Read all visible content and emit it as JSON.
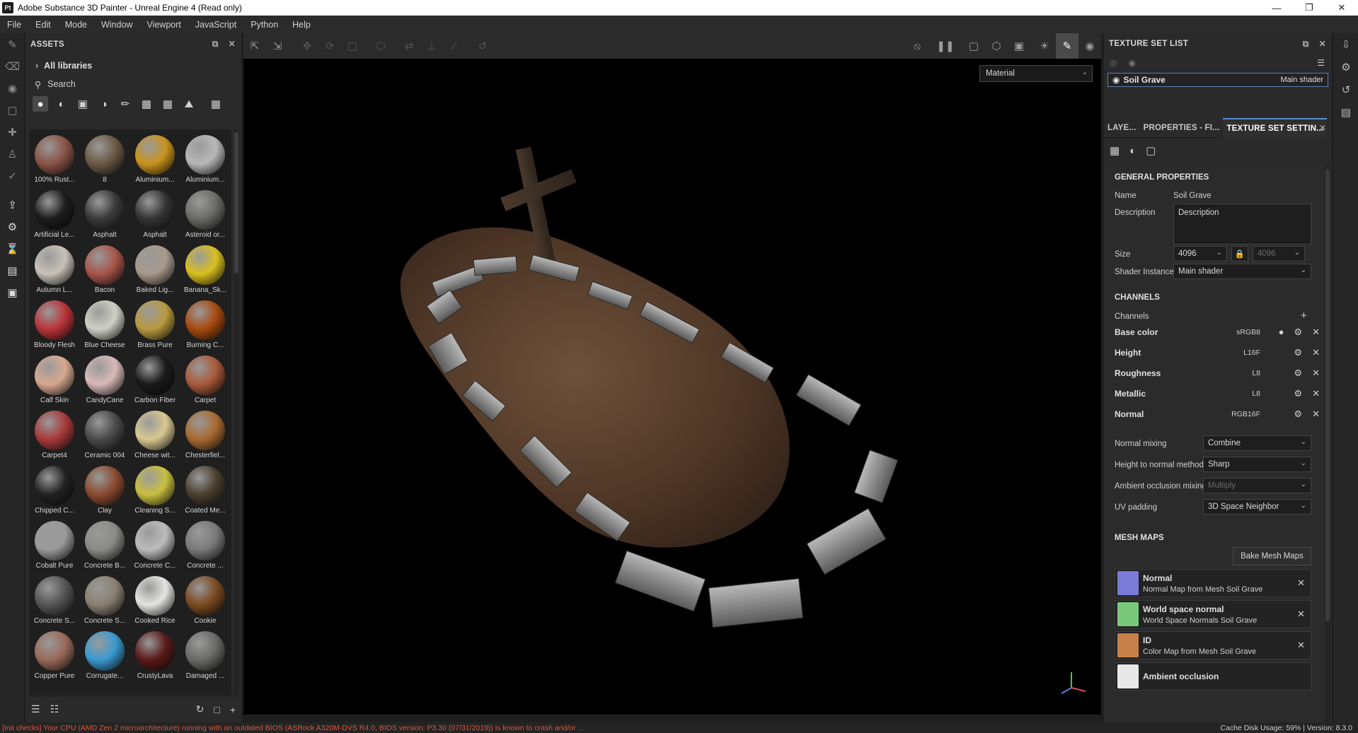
{
  "window": {
    "title": "Adobe Substance 3D Painter - Unreal Engine 4 (Read only)",
    "app_icon": "Pt"
  },
  "menu": [
    "File",
    "Edit",
    "Mode",
    "Window",
    "Viewport",
    "JavaScript",
    "Python",
    "Help"
  ],
  "assets": {
    "title": "ASSETS",
    "libraries": "All libraries",
    "search_placeholder": "Search",
    "items": [
      {
        "label": "100% Rust...",
        "color": "#8a5346"
      },
      {
        "label": "8",
        "color": "#6b5a44"
      },
      {
        "label": "Aluminium...",
        "color": "#c9931e"
      },
      {
        "label": "Aluminium...",
        "color": "#b8b8b8"
      },
      {
        "label": "Artificial Le...",
        "color": "#1c1c1c"
      },
      {
        "label": "Asphalt",
        "color": "#3a3a3a"
      },
      {
        "label": "Asphalt",
        "color": "#343434"
      },
      {
        "label": "Asteroid or...",
        "color": "#6b6b66"
      },
      {
        "label": "Autumn L...",
        "color": "#c8c0b8"
      },
      {
        "label": "Bacon",
        "color": "#a8554a"
      },
      {
        "label": "Baked Lig...",
        "color": "#a89a8c"
      },
      {
        "label": "Banana_Sk...",
        "color": "#d8c020"
      },
      {
        "label": "Bloody Flesh",
        "color": "#b8343a"
      },
      {
        "label": "Blue Cheese",
        "color": "#cfd0c4"
      },
      {
        "label": "Brass Pure",
        "color": "#b89a40"
      },
      {
        "label": "Burning C...",
        "color": "#a84a10"
      },
      {
        "label": "Calf Skin",
        "color": "#d8a890"
      },
      {
        "label": "CandyCane",
        "color": "#d8b8b8"
      },
      {
        "label": "Carbon Fiber",
        "color": "#1a1a1a"
      },
      {
        "label": "Carpet",
        "color": "#a85a3a"
      },
      {
        "label": "Carpet4",
        "color": "#a83a3a"
      },
      {
        "label": "Ceramic 004",
        "color": "#4a4a4a"
      },
      {
        "label": "Cheese wit...",
        "color": "#d8c890"
      },
      {
        "label": "Chesterfiel...",
        "color": "#a86a30"
      },
      {
        "label": "Chipped C...",
        "color": "#222222"
      },
      {
        "label": "Clay",
        "color": "#8a4a30"
      },
      {
        "label": "Cleaning S...",
        "color": "#c8c040"
      },
      {
        "label": "Coated Me...",
        "color": "#4a4030"
      },
      {
        "label": "Cobalt Pure",
        "color": "#9a9a9a"
      },
      {
        "label": "Concrete B...",
        "color": "#8a8a86"
      },
      {
        "label": "Concrete C...",
        "color": "#bcbcbc"
      },
      {
        "label": "Concrete ...",
        "color": "#7a7a7a"
      },
      {
        "label": "Concrete S...",
        "color": "#555555"
      },
      {
        "label": "Concrete S...",
        "color": "#8a8070"
      },
      {
        "label": "Cooked Rice",
        "color": "#e4e4e0"
      },
      {
        "label": "Cookie",
        "color": "#7a4a20"
      },
      {
        "label": "Copper Pure",
        "color": "#9a6a5a"
      },
      {
        "label": "Corrugate...",
        "color": "#3a9ad0"
      },
      {
        "label": "CrustyLava",
        "color": "#5a1a1a"
      },
      {
        "label": "Damaged ...",
        "color": "#6a6a68"
      }
    ]
  },
  "viewport": {
    "material_mode": "Material"
  },
  "texture_set_list": {
    "title": "TEXTURE SET LIST",
    "item_name": "Soil Grave",
    "item_shader": "Main shader"
  },
  "tabs": [
    "LAYE...",
    "PROPERTIES - FI...",
    "TEXTURE SET SETTIN..."
  ],
  "tss": {
    "general_title": "GENERAL PROPERTIES",
    "name_label": "Name",
    "name_value": "Soil Grave",
    "desc_label": "Description",
    "desc_value": "Description",
    "size_label": "Size",
    "size_value": "4096",
    "size_value2": "4096",
    "shader_label": "Shader Instance",
    "shader_value": "Main shader",
    "channels_title": "CHANNELS",
    "channels_label": "Channels",
    "channels": [
      {
        "name": "Base color",
        "format": "sRGB8"
      },
      {
        "name": "Height",
        "format": "L16F"
      },
      {
        "name": "Roughness",
        "format": "L8"
      },
      {
        "name": "Metallic",
        "format": "L8"
      },
      {
        "name": "Normal",
        "format": "RGB16F"
      }
    ],
    "normal_mixing_label": "Normal mixing",
    "normal_mixing_value": "Combine",
    "h2n_label": "Height to normal method",
    "h2n_value": "Sharp",
    "ao_label": "Ambient occlusion mixing",
    "ao_value": "Multiply",
    "uv_label": "UV padding",
    "uv_value": "3D Space Neighbor",
    "mesh_title": "MESH MAPS",
    "bake_button": "Bake Mesh Maps",
    "mesh_maps": [
      {
        "name": "Normal",
        "desc": "Normal Map from Mesh Soil Grave",
        "color": "#7a7ad8"
      },
      {
        "name": "World space normal",
        "desc": "World Space Normals Soil Grave",
        "color": "#7ac87a"
      },
      {
        "name": "ID",
        "desc": "Color Map from Mesh Soil Grave",
        "color": "#c8804a"
      },
      {
        "name": "Ambient occlusion",
        "desc": "",
        "color": "#e8e8e8"
      }
    ]
  },
  "status": {
    "error": "[Init checks] Your CPU (AMD Zen 2 microarchitecture) running with an outdated BIOS (ASRock A320M-DVS R4.0, BIOS version: P3.30 (07/31/2019)) is known to crash and/or ...",
    "right": "Cache Disk Usage:   59% | Version: 8.3.0"
  }
}
